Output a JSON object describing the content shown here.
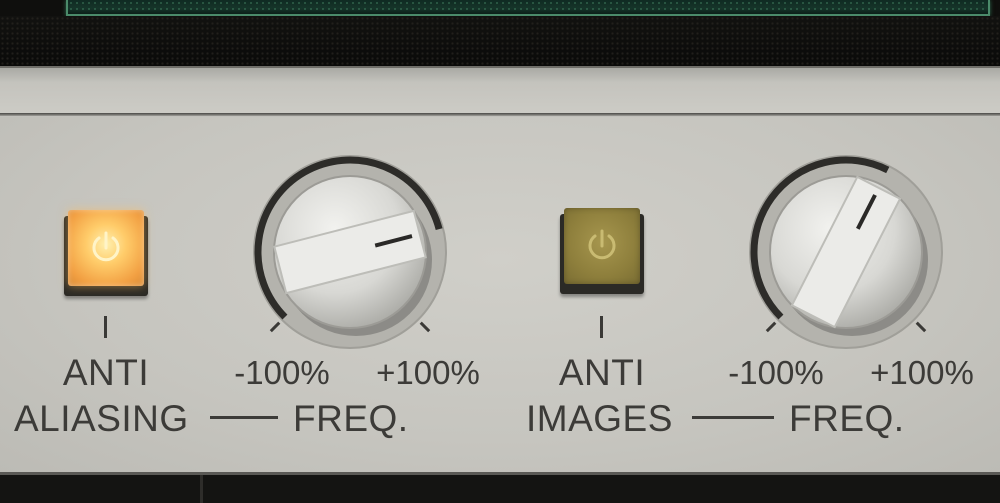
{
  "colors": {
    "panel": "#c6c5bf",
    "text": "#3c3b38",
    "lamp_on": "#ffcc6a",
    "lamp_off": "#8e7f3c",
    "display_green": "#4b8b6a"
  },
  "group_aliasing": {
    "button": {
      "icon": "power-icon",
      "state": "on"
    },
    "label_line1": "ANTI",
    "label_line2": "ALIASING",
    "knob": {
      "icon": "frequency-knob",
      "label": "FREQ.",
      "min_label": "-100%",
      "max_label": "+100%",
      "value_fraction": 0.78
    }
  },
  "group_images": {
    "button": {
      "icon": "power-icon",
      "state": "off"
    },
    "label_line1": "ANTI",
    "label_line2": "IMAGES",
    "knob": {
      "icon": "frequency-knob",
      "label": "FREQ.",
      "min_label": "-100%",
      "max_label": "+100%",
      "value_fraction": 0.6
    }
  }
}
